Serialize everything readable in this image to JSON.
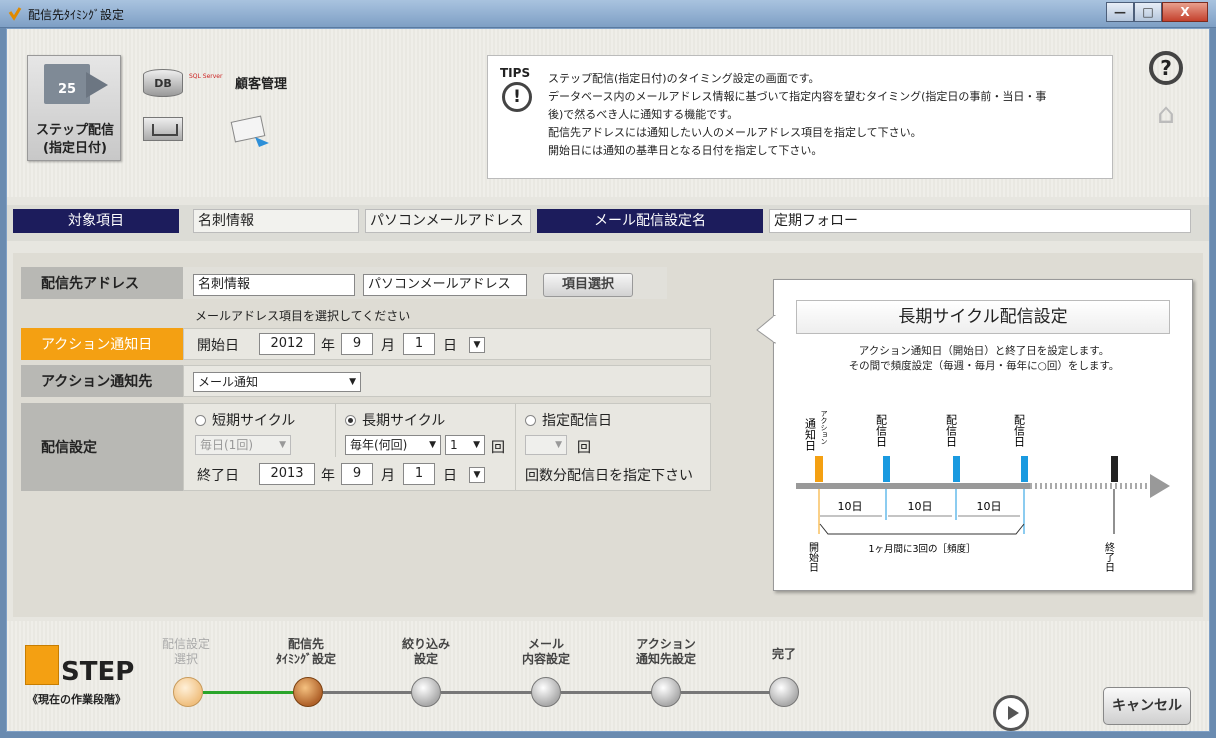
{
  "window": {
    "title": "配信先ﾀｲﾐﾝｸﾞ設定",
    "min": "—",
    "max": "□",
    "close": "X"
  },
  "header": {
    "step_tile": {
      "calendar_num": "25",
      "label_line1": "ステップ配信",
      "label_line2": "(指定日付)"
    },
    "db_label": "DB",
    "sql_logo": "SQL Server",
    "customer_label": "顧客管理",
    "tips": {
      "heading": "TIPS",
      "icon": "!",
      "lines": [
        "ステップ配信(指定日付)のタイミング設定の画面です。",
        "データベース内のメールアドレス情報に基づいて指定内容を望むタイミング(指定日の事前・当日・事",
        "後)で然るべき人に通知する機能です。",
        "配信先アドレスには通知したい人のメールアドレス項目を指定して下さい。",
        "開始日には通知の基準日となる日付を指定して下さい。"
      ]
    },
    "help_icon": "?",
    "home_icon": "⌂"
  },
  "target": {
    "label": "対象項目",
    "value1": "名刺情報",
    "value2": "パソコンメールアドレス",
    "setting_label": "メール配信設定名",
    "setting_value": "定期フォロー"
  },
  "form": {
    "address": {
      "label": "配信先アドレス",
      "field1": "名刺情報",
      "field2": "パソコンメールアドレス",
      "select_button": "項目選択",
      "hint": "メールアドレス項目を選択してください"
    },
    "action_date": {
      "label": "アクション通知日",
      "start_label": "開始日",
      "year": "2012",
      "year_unit": "年",
      "month": "9",
      "month_unit": "月",
      "day": "1",
      "day_unit": "日"
    },
    "action_target": {
      "label": "アクション通知先",
      "value": "メール通知"
    },
    "delivery": {
      "label": "配信設定",
      "short_cycle": "短期サイクル",
      "long_cycle": "長期サイクル",
      "specified": "指定配信日",
      "short_select": "毎日(1回)",
      "long_select": "毎年(何回)",
      "long_count": "1",
      "times_unit": "回",
      "specified_times": "回",
      "end_label": "終了日",
      "end_year": "2013",
      "end_year_unit": "年",
      "end_month": "9",
      "end_month_unit": "月",
      "end_day": "1",
      "end_day_unit": "日",
      "specified_hint": "回数分配信日を指定下さい"
    }
  },
  "card": {
    "title": "長期サイクル配信設定",
    "desc_line1": "アクション通知日（開始日）と終了日を設定します。",
    "desc_line2": "その間で頻度設定（毎週・毎月・毎年に○回）をします。",
    "diagram": {
      "notify_label": "通知日",
      "action_small": "アクション",
      "delivery_label": "配信日",
      "interval": "10日",
      "start_label": "開始日",
      "end_label": "終了日",
      "frequency": "1ヶ月間に3回の［頻度］"
    }
  },
  "steps": {
    "logo_word": "STEP",
    "caption": "《現在の作業段階》",
    "items": [
      {
        "line1": "配信設定",
        "line2": "選択"
      },
      {
        "line1": "配信先",
        "line2": "ﾀｲﾐﾝｸﾞ設定"
      },
      {
        "line1": "絞り込み",
        "line2": "設定"
      },
      {
        "line1": "メール",
        "line2": "内容設定"
      },
      {
        "line1": "アクション",
        "line2": "通知先設定"
      },
      {
        "line1": "完了",
        "line2": ""
      }
    ],
    "cancel": "キャンセル"
  },
  "colors": {
    "accent_orange": "#f4a012",
    "navy": "#1c1c5c",
    "step_done_line": "#2aa52a",
    "marker_blue": "#1a9ae0"
  }
}
